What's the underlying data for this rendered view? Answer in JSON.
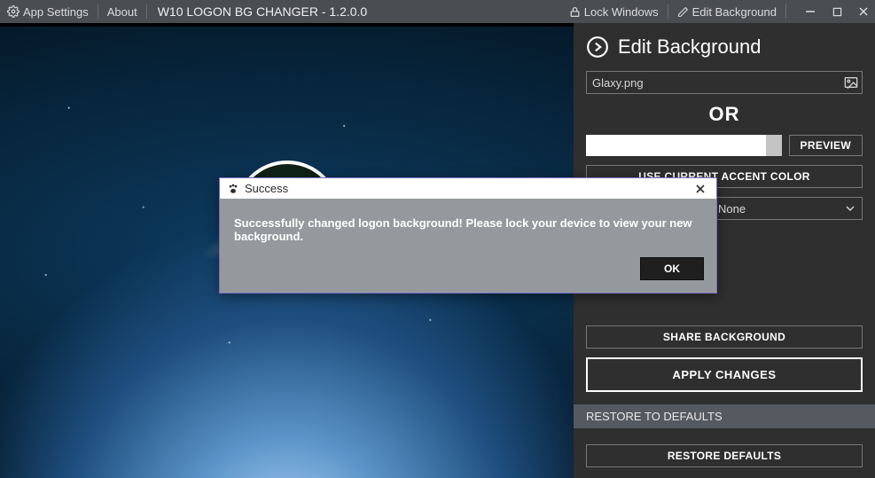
{
  "header": {
    "app_settings": "App Settings",
    "about": "About",
    "title": "W10 LOGON BG CHANGER - 1.2.0.0",
    "lock_windows": "Lock Windows",
    "edit_background": "Edit Background"
  },
  "panel": {
    "title": "Edit Background",
    "file_value": "Glaxy.png",
    "or_label": "OR",
    "preview_btn": "PREVIEW",
    "use_accent_btn": "USE CURRENT ACCENT COLOR",
    "select_value": "None",
    "share_btn": "SHARE BACKGROUND",
    "apply_btn": "APPLY CHANGES",
    "restore_header": "RESTORE TO DEFAULTS",
    "restore_btn": "RESTORE DEFAULTS"
  },
  "dialog": {
    "title": "Success",
    "message": "Successfully changed logon background! Please lock your device to view your new background.",
    "ok": "OK"
  }
}
